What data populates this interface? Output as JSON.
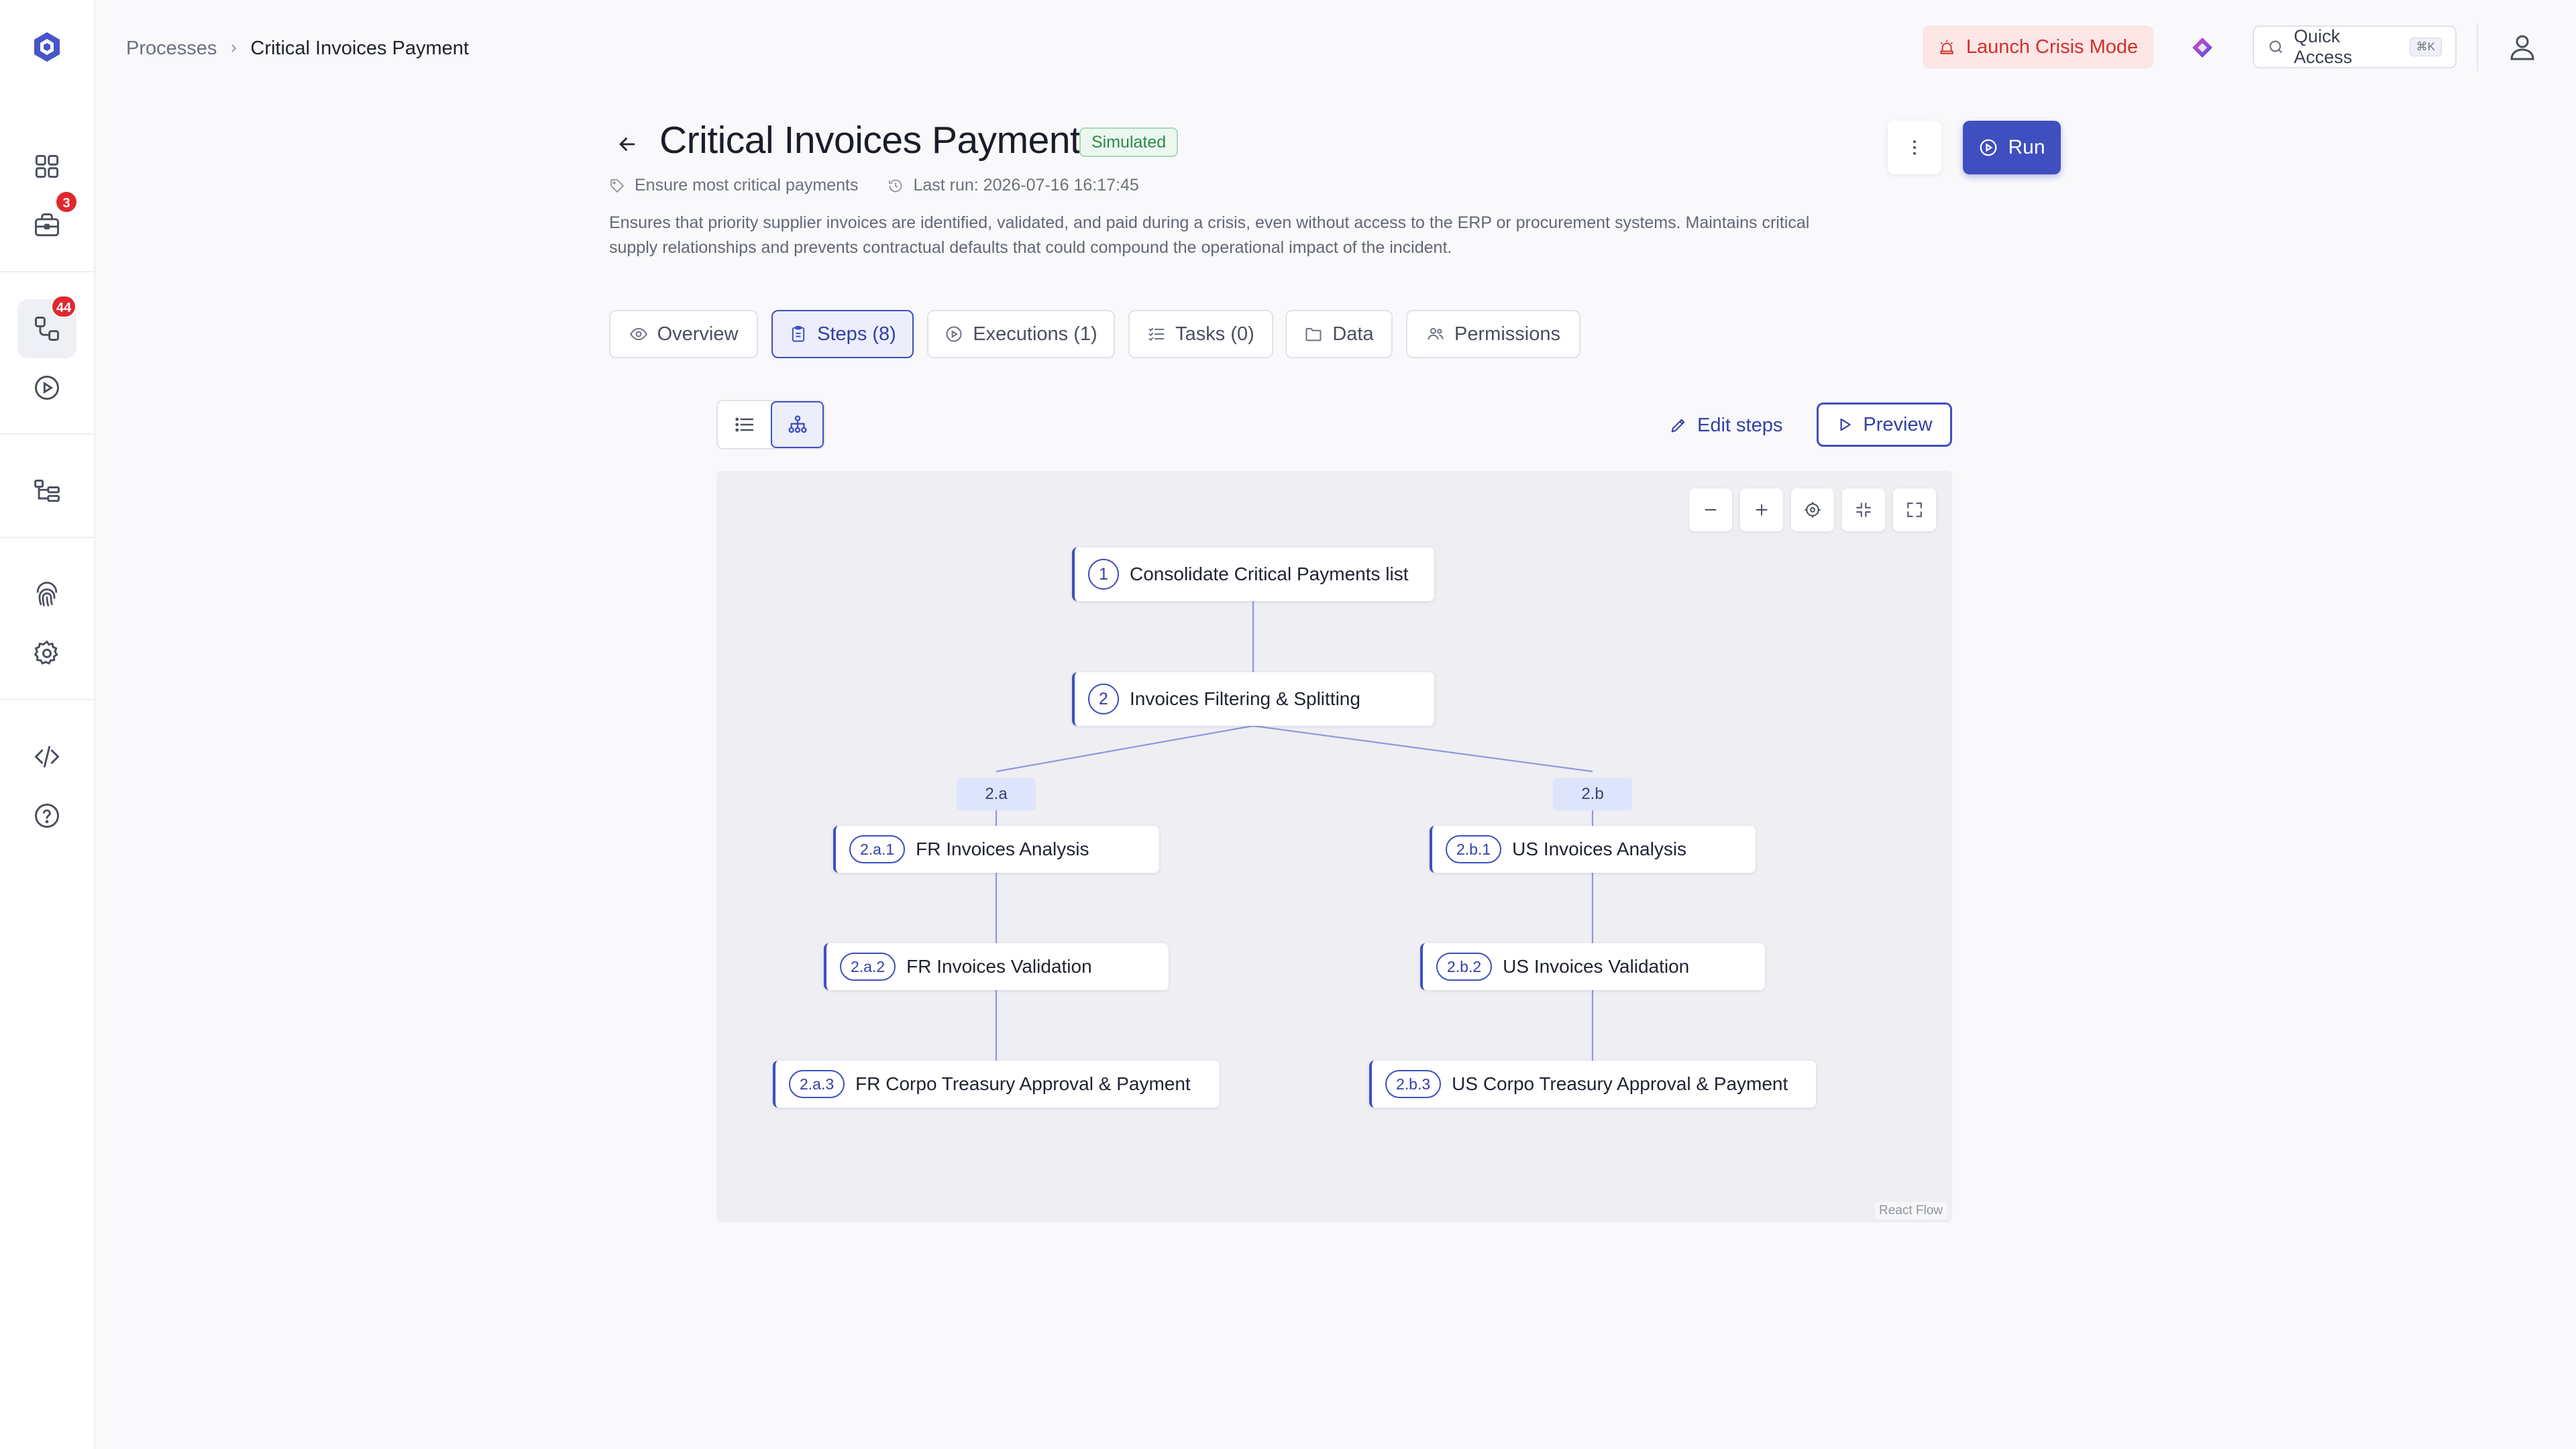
{
  "sidebar": {
    "badges": {
      "workspace": "3",
      "processes": "44"
    }
  },
  "breadcrumb": {
    "parent": "Processes",
    "current": "Critical Invoices Payment"
  },
  "topbar": {
    "crisis_button": "Launch Crisis Mode",
    "quick_access": "Quick Access",
    "quick_access_shortcut": "⌘K"
  },
  "header": {
    "title": "Critical Invoices Payment",
    "status": "Simulated",
    "tag": "Ensure most critical payments",
    "last_run": "Last run: 2026-07-16 16:17:45",
    "description": "Ensures that priority supplier invoices are identified, validated, and paid during a crisis, even without access to the ERP or procurement systems. Maintains critical supply relationships and prevents contractual defaults that could compound the operational impact of the incident.",
    "run_label": "Run"
  },
  "tabs": [
    {
      "label": "Overview"
    },
    {
      "label": "Steps (8)"
    },
    {
      "label": "Executions (1)"
    },
    {
      "label": "Tasks (0)"
    },
    {
      "label": "Data"
    },
    {
      "label": "Permissions"
    }
  ],
  "actions": {
    "edit_steps": "Edit steps",
    "preview": "Preview"
  },
  "flow": {
    "nodes": [
      {
        "num": "1",
        "label": "Consolidate Critical Payments list"
      },
      {
        "num": "2",
        "label": "Invoices Filtering & Splitting"
      },
      {
        "num": "2.a.1",
        "label": "FR Invoices Analysis"
      },
      {
        "num": "2.a.2",
        "label": "FR Invoices Validation"
      },
      {
        "num": "2.a.3",
        "label": "FR Corpo Treasury Approval & Payment"
      },
      {
        "num": "2.b.1",
        "label": "US Invoices Analysis"
      },
      {
        "num": "2.b.2",
        "label": "US Invoices Validation"
      },
      {
        "num": "2.b.3",
        "label": "US Corpo Treasury Approval & Payment"
      }
    ],
    "branches": [
      "2.a",
      "2.b"
    ],
    "attribution": "React Flow"
  },
  "colors": {
    "accent": "#3f4fc0",
    "crisis": "#d0312d",
    "badge": "#e0282e"
  }
}
